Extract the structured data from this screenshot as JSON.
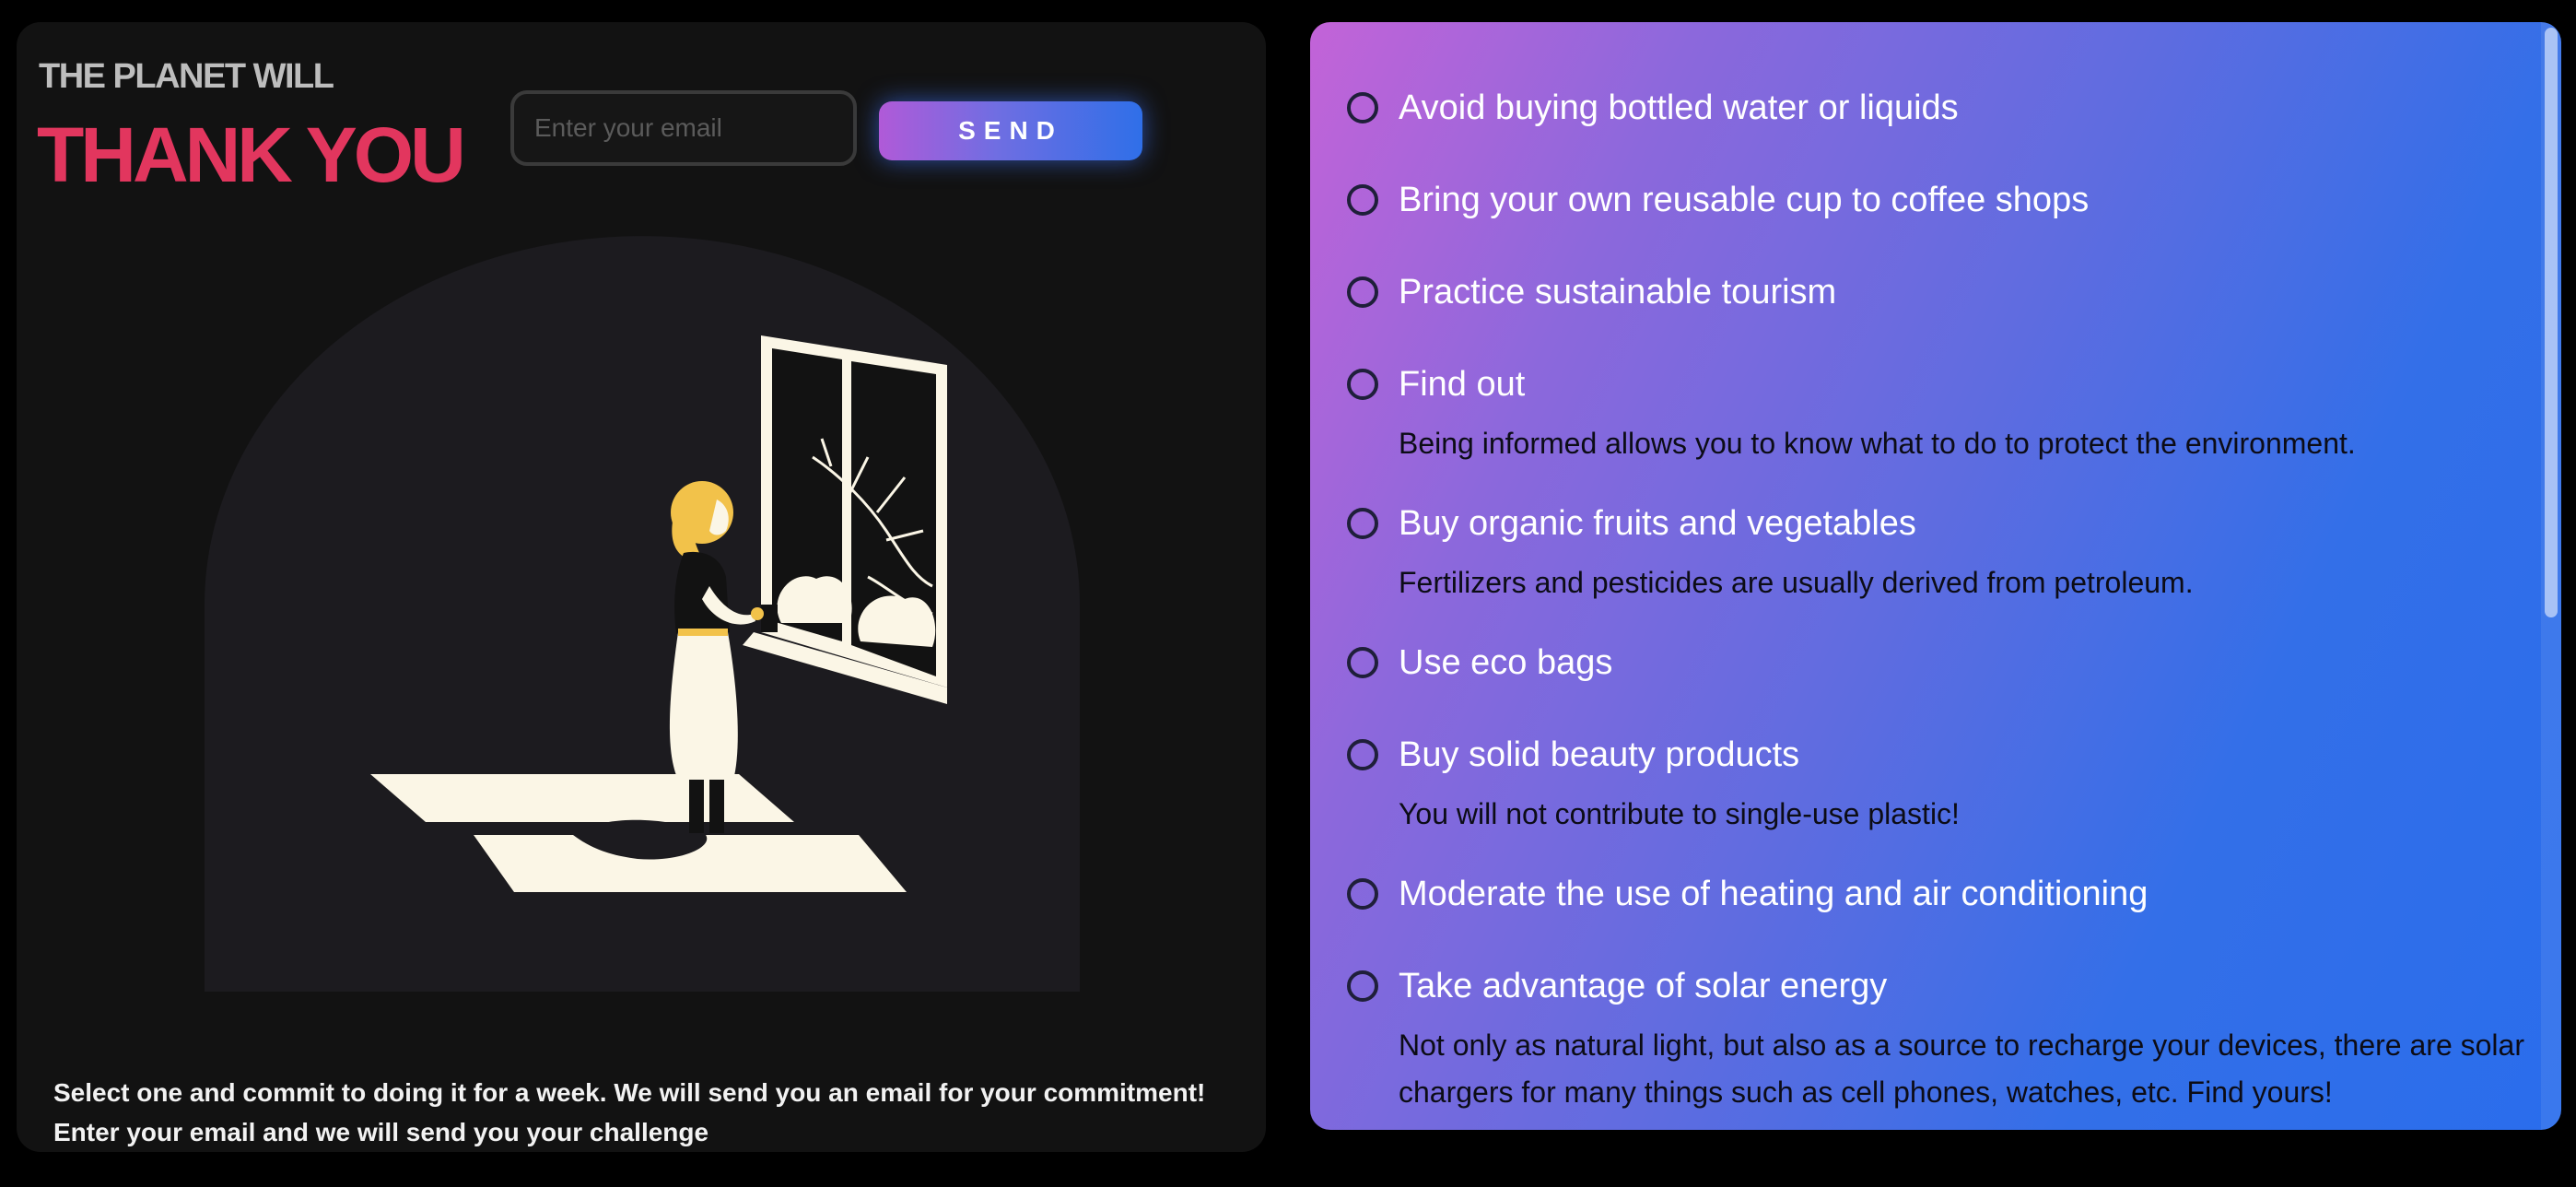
{
  "hero": {
    "eyebrow": "THE PLANET WILL",
    "title": "THANK YOU"
  },
  "form": {
    "email_placeholder": "Enter your email",
    "email_value": "",
    "send_label": "SEND"
  },
  "caption": {
    "line1": "Select one and commit to doing it for a week. We will send you an email for your commitment!",
    "line2": "Enter your email and we will send you your challenge"
  },
  "illustration": {
    "icon": "woman-at-window-illustration"
  },
  "challenges": [
    {
      "title": "Avoid buying bottled water or liquids",
      "desc": ""
    },
    {
      "title": "Bring your own reusable cup to coffee shops",
      "desc": ""
    },
    {
      "title": "Practice sustainable tourism",
      "desc": ""
    },
    {
      "title": "Find out",
      "desc": "Being informed allows you to know what to do to protect the environment."
    },
    {
      "title": "Buy organic fruits and vegetables",
      "desc": "Fertilizers and pesticides are usually derived from petroleum."
    },
    {
      "title": "Use eco bags",
      "desc": ""
    },
    {
      "title": "Buy solid beauty products",
      "desc": "You will not contribute to single-use plastic!"
    },
    {
      "title": "Moderate the use of heating and air conditioning",
      "desc": ""
    },
    {
      "title": "Take advantage of solar energy",
      "desc": "Not only as natural light, but also as a source to recharge your devices, there are solar chargers for many things such as cell phones, watches, etc. Find yours!"
    }
  ],
  "colors": {
    "accent_title": "#e2365e",
    "gradient_start": "#c363d8",
    "gradient_end": "#2a6dec"
  }
}
